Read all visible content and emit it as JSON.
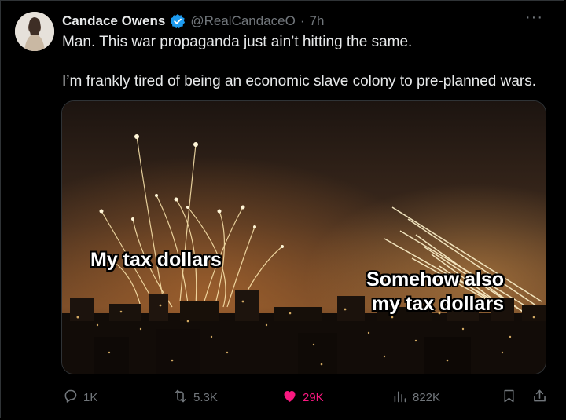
{
  "post": {
    "author_name": "Candace Owens",
    "handle": "@RealCandaceO",
    "separator": "·",
    "time": "7h",
    "more": "···",
    "text_line1": "Man. This war propaganda just ain’t hitting the same.",
    "text_line2": "I’m frankly tired of being an economic slave colony to pre-planned wars.",
    "media": {
      "caption_left": "My tax dollars",
      "caption_right_line1": "Somehow also",
      "caption_right_line2": "my tax dollars"
    }
  },
  "actions": {
    "reply_count": "1K",
    "repost_count": "5.3K",
    "like_count": "29K",
    "views_count": "822K"
  },
  "icons": {
    "verified": "verified-badge-icon",
    "reply": "reply-icon",
    "repost": "repost-icon",
    "like": "heart-icon",
    "views": "views-icon",
    "bookmark": "bookmark-icon",
    "share": "share-icon"
  },
  "colors": {
    "background": "#000000",
    "text": "#e7e9ea",
    "muted": "#71767b",
    "verified": "#1d9bf0",
    "like": "#f91880"
  }
}
